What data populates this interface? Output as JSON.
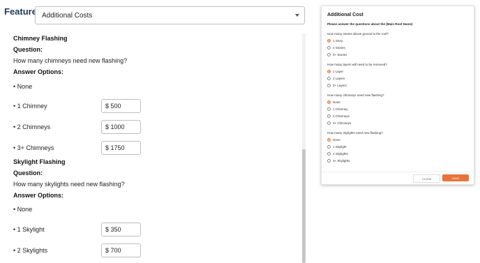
{
  "feature": {
    "label": "Feature:",
    "selected": "Additional Costs"
  },
  "chimney": {
    "title": "Chimney Flashing",
    "question_label": "Question:",
    "question": "How many chimneys need new flashing?",
    "answers_label": "Answer Options:",
    "options": [
      {
        "label": "• None"
      },
      {
        "label": "• 1 Chimney",
        "price": "$ 500"
      },
      {
        "label": "• 2 Chimneys",
        "price": "$ 1000"
      },
      {
        "label": "• 3+ Chimneys",
        "price": "$ 1750"
      }
    ]
  },
  "skylight": {
    "title": "Skylight Flashing",
    "question_label": "Question:",
    "question": "How many skylights need new flashing?",
    "answers_label": "Answer Options:",
    "options": [
      {
        "label": "• None"
      },
      {
        "label": "• 1 Skylight",
        "price": "$ 350"
      },
      {
        "label": "• 2 Skylights",
        "price": "$ 700"
      }
    ]
  },
  "modal": {
    "title": "Additional Cost",
    "subtitle": "Please answer the questions about the (Main Roof Name)",
    "groups": [
      {
        "question": "How many stories above ground is the roof?",
        "options": [
          {
            "label": "1 Story",
            "selected": true
          },
          {
            "label": "2 Stories",
            "selected": false
          },
          {
            "label": "3+ Stories",
            "selected": false
          }
        ]
      },
      {
        "question": "How many layers will need to be removed?",
        "options": [
          {
            "label": "1 Layer",
            "selected": true
          },
          {
            "label": "2 Layers",
            "selected": false
          },
          {
            "label": "3+ Layers",
            "selected": false
          }
        ]
      },
      {
        "question": "How many chimneys need new flashing?",
        "options": [
          {
            "label": "None",
            "selected": true
          },
          {
            "label": "1 Chimney",
            "selected": false
          },
          {
            "label": "2 Chimneys",
            "selected": false
          },
          {
            "label": "3+ Chimneys",
            "selected": false
          }
        ]
      },
      {
        "question": "How many skylights need new flashing?",
        "options": [
          {
            "label": "None",
            "selected": true
          },
          {
            "label": "1 Skylight",
            "selected": false
          },
          {
            "label": "2 Skylights",
            "selected": false
          },
          {
            "label": "3+ Skylights",
            "selected": false
          }
        ]
      }
    ],
    "close_label": "CLOSE",
    "save_label": "SAVE"
  },
  "colors": {
    "accent": "#e8743b",
    "feature_label": "#1f3a5a"
  }
}
